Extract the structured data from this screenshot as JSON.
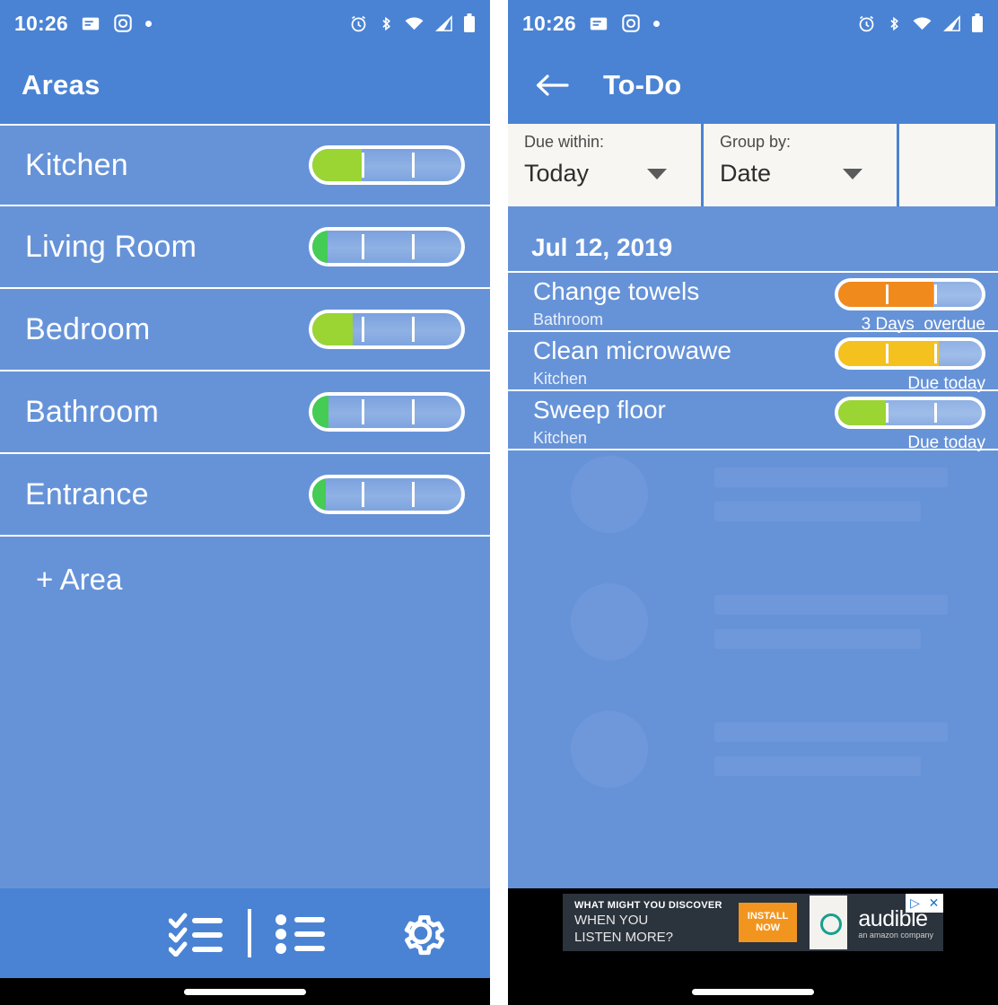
{
  "colors": {
    "app_blue": "#4a83d4",
    "list_blue": "#6693d8",
    "green_light": "#9ad534",
    "green": "#44cc55",
    "amber": "#f5c11e",
    "orange": "#f08a1c",
    "white": "#ffffff",
    "ad_bg": "#2b333d",
    "ad_cta": "#f2951f"
  },
  "status_bar": {
    "time": "10:26",
    "left_icons": [
      "message-icon",
      "camera-icon",
      "dot-icon"
    ],
    "right_icons": [
      "alarm-icon",
      "bluetooth-icon",
      "wifi-icon",
      "signal-icon",
      "battery-icon"
    ]
  },
  "left_screen": {
    "title": "Areas",
    "areas": [
      {
        "name": "Kitchen",
        "progress": 33,
        "color": "#9ad534"
      },
      {
        "name": "Living Room",
        "progress": 10,
        "color": "#44cc55"
      },
      {
        "name": "Bedroom",
        "progress": 27,
        "color": "#9ad534"
      },
      {
        "name": "Bathroom",
        "progress": 11,
        "color": "#44cc55"
      },
      {
        "name": "Entrance",
        "progress": 9,
        "color": "#44cc55"
      }
    ],
    "add_area_label": "+ Area",
    "bottom_nav": [
      {
        "name": "checklist-icon",
        "label": "To-Do"
      },
      {
        "name": "bulleted-list-icon",
        "label": "Areas"
      },
      {
        "name": "gear-icon",
        "label": "Settings"
      }
    ]
  },
  "right_screen": {
    "title": "To-Do",
    "back_icon": "arrow-left-icon",
    "filters": [
      {
        "label": "Due within:",
        "value": "Today"
      },
      {
        "label": "Group by:",
        "value": "Date"
      }
    ],
    "group_header": "Jul 12, 2019",
    "tasks": [
      {
        "title": "Change towels",
        "area": "Bathroom",
        "due": "3 Days  overdue",
        "progress": 66,
        "color": "#f08a1c"
      },
      {
        "title": "Clean microwawe",
        "area": "Kitchen",
        "due": "Due today",
        "progress": 70,
        "color": "#f5c11e"
      },
      {
        "title": "Sweep floor",
        "area": "Kitchen",
        "due": "Due today",
        "progress": 33,
        "color": "#9ad534"
      }
    ],
    "ad": {
      "kicker": "WHAT MIGHT YOU DISCOVER",
      "headline_line1": "WHEN YOU",
      "headline_line2": "LISTEN MORE?",
      "cta_line1": "INSTALL",
      "cta_line2": "NOW",
      "brand": "audible",
      "brand_sub": "an amazon company",
      "badges": [
        "adchoices-icon",
        "close-icon"
      ]
    }
  }
}
